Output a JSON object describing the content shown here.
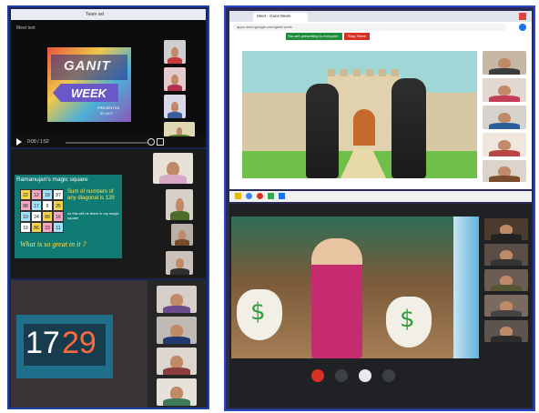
{
  "top_left": {
    "menu_label": "Team sel",
    "top_caption": "Meet text",
    "slide": {
      "title_line1": "GANIT",
      "title_line2": "WEEK",
      "subtitle1": "PRESENTED",
      "subtitle2": "BY ACT"
    },
    "time": "0:00 / 1:52"
  },
  "magic_square": {
    "title": "Ramanujan's magic square",
    "grid": [
      [
        "22",
        "12",
        "18",
        "87"
      ],
      [
        "88",
        "17",
        "9",
        "25"
      ],
      [
        "10",
        "24",
        "89",
        "16"
      ],
      [
        "19",
        "86",
        "23",
        "11"
      ]
    ],
    "caption1": "Sum of numbers of any diagonal is 139",
    "caption2": "ok this will be there in my magic square",
    "question": "What is so great in it ?"
  },
  "number_slide": {
    "digits_a": "17",
    "digits_b": "29"
  },
  "browser_top": {
    "tab_title": "Meet - Ganit Week",
    "url": "apps.meet.google.com/ganit-week",
    "banner_text": "You are presenting to everyone",
    "stop_label": "Stop Share"
  },
  "browser_bottom": {
    "call_controls": [
      "end-call",
      "camera",
      "mic",
      "more"
    ]
  },
  "colors": {
    "left_border": "#1f3fa8",
    "right_border": "#2b47c9",
    "end_call": "#d93025",
    "castle_sky": "#9ed7d6",
    "money_green": "#2e9e3e"
  }
}
